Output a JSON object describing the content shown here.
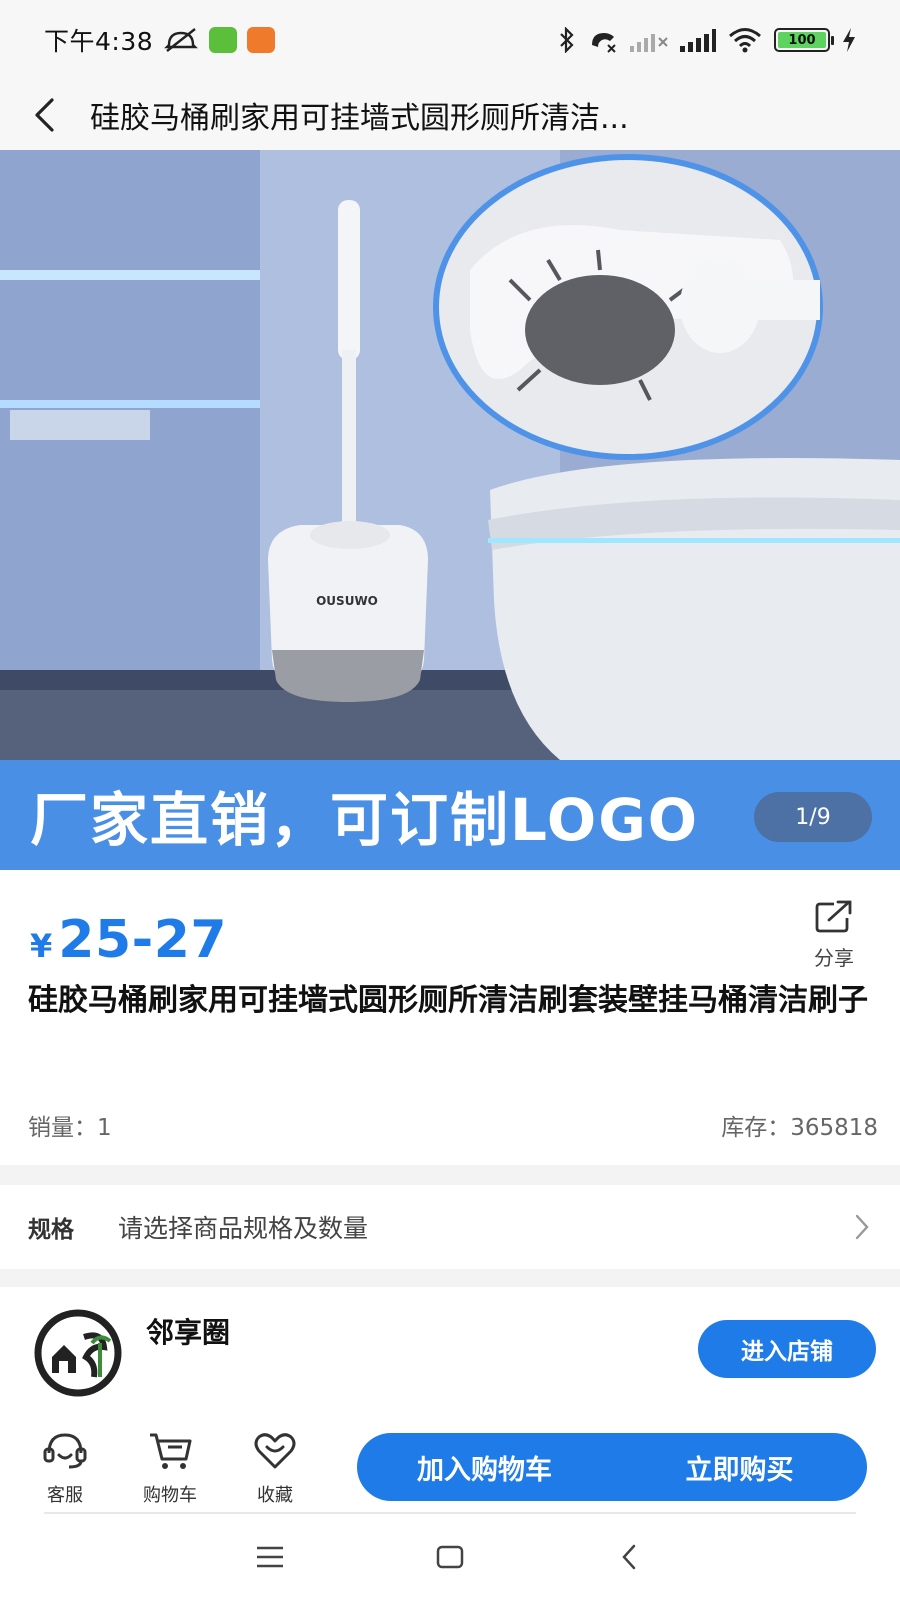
{
  "status": {
    "time": "下午4:38",
    "battery": "100"
  },
  "header": {
    "title": "硅胶马桶刷家用可挂墙式圆形厕所清洁..."
  },
  "gallery": {
    "banner_text": "厂家直销，可订制LOGO",
    "brand_on_product": "OUSUWO",
    "counter": "1/9"
  },
  "product": {
    "currency": "¥",
    "price": "25-27",
    "share_label": "分享",
    "name": "硅胶马桶刷家用可挂墙式圆形厕所清洁刷套装壁挂马桶清洁刷子",
    "sales": "销量：1",
    "stock": "库存：365818"
  },
  "spec": {
    "label": "规格",
    "value": "请选择商品规格及数量"
  },
  "shop": {
    "name": "邻享圈",
    "enter_label": "进入店铺"
  },
  "actions": {
    "service_label": "客服",
    "cart_label": "购物车",
    "favorite_label": "收藏",
    "add_to_cart_label": "加入购物车",
    "buy_now_label": "立即购买"
  },
  "colors": {
    "accent": "#1e7be8",
    "banner": "#4a8fe6"
  },
  "icons": [
    "back-icon",
    "share-icon",
    "chevron-right-icon",
    "headset-icon",
    "cart-icon",
    "heart-icon",
    "menu-icon",
    "home-icon",
    "nav-back-icon"
  ]
}
